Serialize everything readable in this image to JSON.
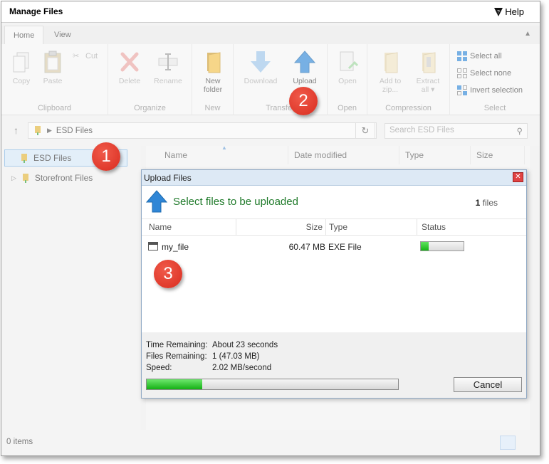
{
  "window": {
    "title": "Manage Files",
    "help_label": "Help"
  },
  "ribbon": {
    "tabs": [
      {
        "label": "Home"
      },
      {
        "label": "View"
      }
    ],
    "groups": {
      "clipboard": {
        "label": "Clipboard",
        "copy": "Copy",
        "paste": "Paste",
        "cut": "Cut"
      },
      "organize": {
        "label": "Organize",
        "delete": "Delete",
        "rename": "Rename"
      },
      "new": {
        "label": "New",
        "new_folder_line1": "New",
        "new_folder_line2": "folder"
      },
      "transfer": {
        "label": "Transfer",
        "download": "Download",
        "upload": "Upload"
      },
      "open": {
        "label": "Open",
        "open": "Open"
      },
      "compression": {
        "label": "Compression",
        "add_zip_line1": "Add to",
        "add_zip_line2": "zip...",
        "extract_line1": "Extract",
        "extract_line2": "all ▾"
      },
      "select": {
        "label": "Select",
        "select_all": "Select all",
        "select_none": "Select none",
        "invert": "Invert selection"
      }
    }
  },
  "address": {
    "crumb": "ESD Files",
    "search_placeholder": "Search ESD Files"
  },
  "nav": {
    "items": [
      {
        "label": "ESD Files",
        "selected": true
      },
      {
        "label": "Storefront Files",
        "selected": false
      }
    ]
  },
  "filelist": {
    "columns": [
      "Name",
      "Date modified",
      "Type",
      "Size"
    ]
  },
  "statusbar": {
    "items_label": "0 items"
  },
  "dialog": {
    "title": "Upload Files",
    "heading": "Select files to be uploaded",
    "file_count": "1",
    "file_count_unit": "files",
    "columns": {
      "name": "Name",
      "size": "Size",
      "type": "Type",
      "status": "Status"
    },
    "files": [
      {
        "name": "my_file",
        "size": "60.47 MB",
        "type": "EXE File",
        "progress": 0.18
      }
    ],
    "footer": {
      "time_label": "Time Remaining:",
      "time_value": "About 23 seconds",
      "files_label": "Files Remaining:",
      "files_value": "1 (47.03 MB)",
      "speed_label": "Speed:",
      "speed_value": "2.02 MB/second",
      "overall_progress": 0.22
    },
    "cancel_label": "Cancel"
  },
  "callouts": [
    "1",
    "2",
    "3"
  ],
  "colors": {
    "callout": "#d92c1f",
    "progress": "#17b417",
    "heading_green": "#1f7a2a",
    "selection": "#d4e6f6"
  }
}
